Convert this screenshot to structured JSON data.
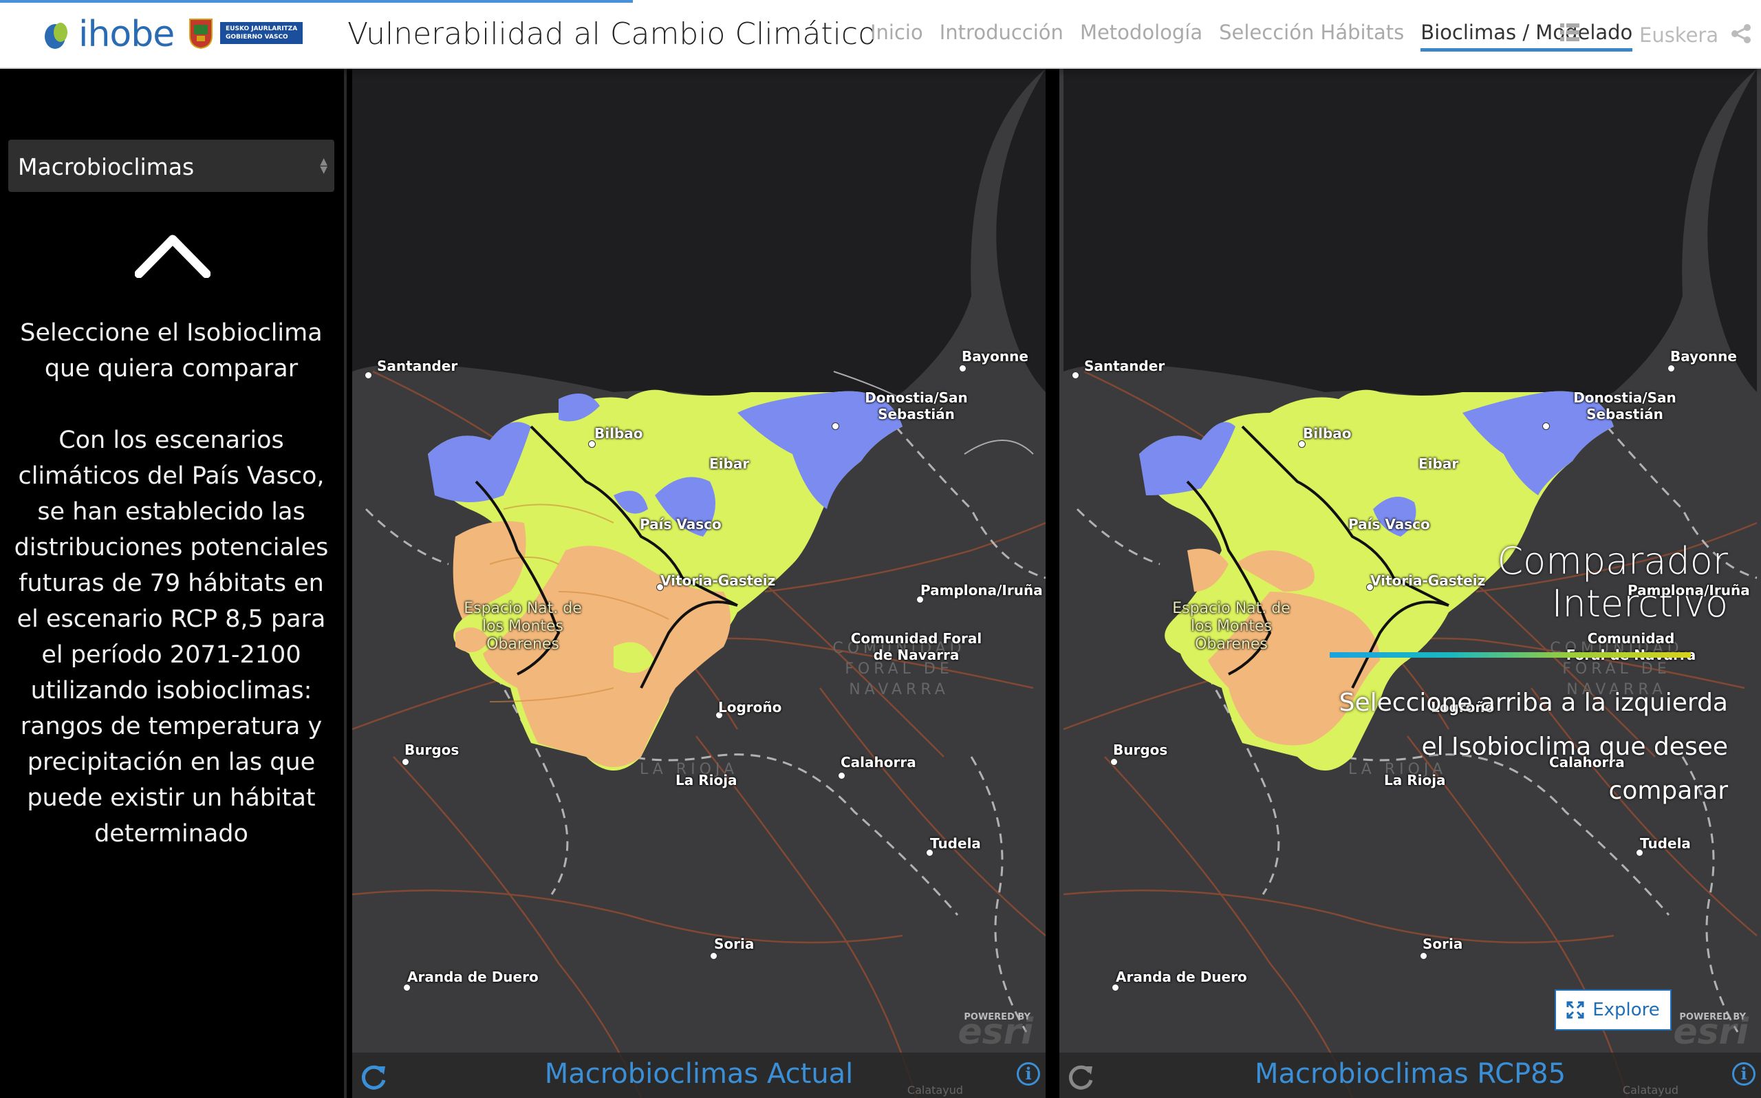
{
  "header": {
    "logo_text": "ihobe",
    "gov_line1": "EUSKO JAURLARITZA",
    "gov_line2": "GOBIERNO VASCO",
    "title": "Vulnerabilidad al Cambio Climático",
    "nav": [
      "Inicio",
      "Introducción",
      "Metodología",
      "Selección Hábitats",
      "Bioclimas / Modelado"
    ],
    "active_nav": "Bioclimas / Modelado",
    "language": "Euskera"
  },
  "sidebar": {
    "select_value": "Macrobioclimas",
    "instruction": "Seleccione el Isobioclima que quiera comparar",
    "description": "Con los escenarios climáticos del País Vasco, se han establecido las distribuciones potenciales futuras de 79 hábitats en el escenario RCP 8,5 para el período 2071-2100 utilizando isobioclimas: rangos de temperatura y precipitación en las que puede existir un hábitat determinado"
  },
  "maps": {
    "left_caption": "Macrobioclimas Actual",
    "right_caption": "Macrobioclimas RCP85",
    "labels": {
      "santander": "Santander",
      "bayonne": "Bayonne",
      "donostia": "Donostia/San Sebastián",
      "bilbao": "Bilbao",
      "eibar": "Eibar",
      "pais_vasco": "País Vasco",
      "vitoria": "Vitoria-Gasteiz",
      "pamplona": "Pamplona/Iruña",
      "espacio": "Espacio Nat. de los Montes Obarenes",
      "navarra": "Comunidad Foral de Navarra",
      "navarra_region": "COMUNIDAD FORAL DE NAVARRA",
      "logrono": "Logroño",
      "burgos": "Burgos",
      "calahorra": "Calahorra",
      "la_rioja": "La Rioja",
      "la_rioja_region": "LA RIOJA",
      "tudela": "Tudela",
      "soria": "Soria",
      "aranda": "Aranda de Duero",
      "calatayud": "Calatayud"
    },
    "powered_by": "POWERED BY",
    "esri": "esri"
  },
  "overlay": {
    "title_line1": "Comparador",
    "title_line2": "Interctivo",
    "sub_line1": "Seleccione arriba a la izquierda",
    "sub_line2": "el Isobioclima que desee",
    "sub_line3": "comparar",
    "explore": "Explore"
  },
  "colors": {
    "blue": "#7c8cf0",
    "lime": "#d8f25a",
    "orange": "#f2b77a",
    "accent": "#3a8fd6"
  }
}
